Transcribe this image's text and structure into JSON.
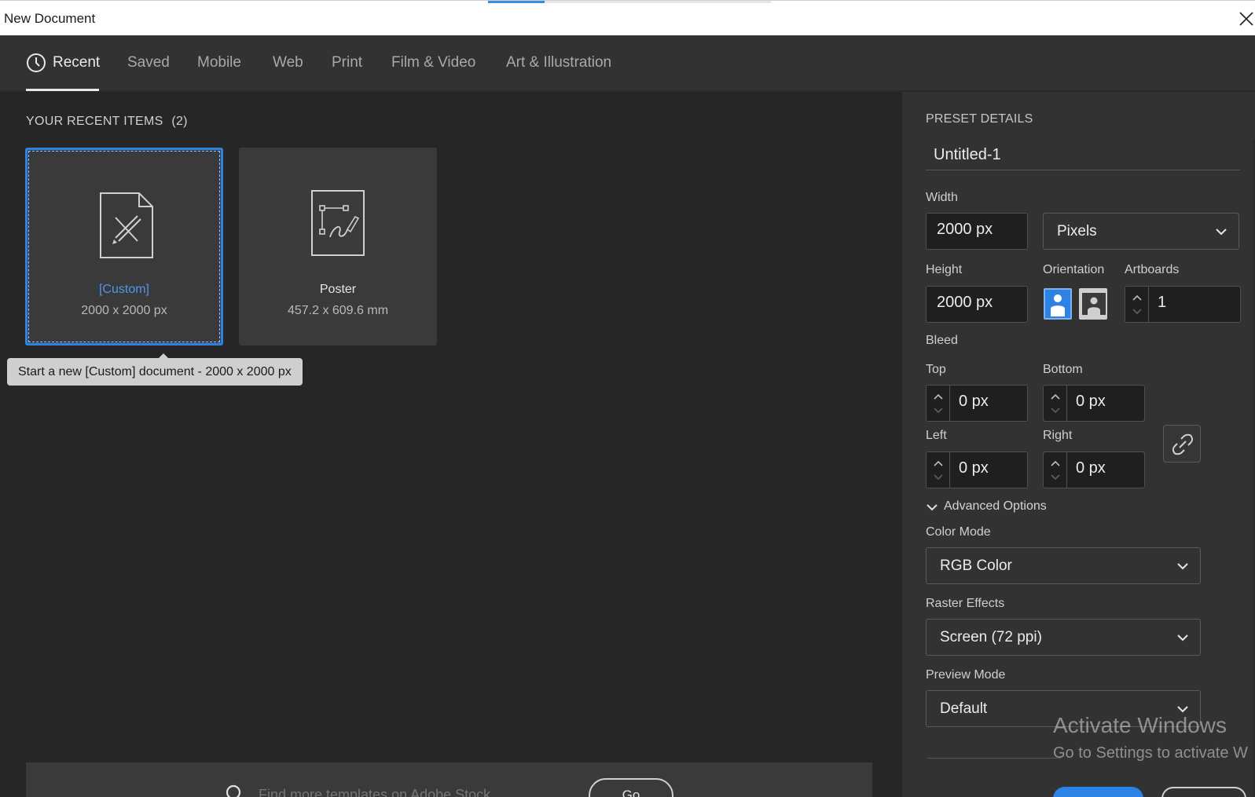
{
  "window": {
    "title": "New Document"
  },
  "tabs": [
    {
      "label": "Recent",
      "active": true
    },
    {
      "label": "Saved"
    },
    {
      "label": "Mobile"
    },
    {
      "label": "Web"
    },
    {
      "label": "Print"
    },
    {
      "label": "Film & Video"
    },
    {
      "label": "Art & Illustration"
    }
  ],
  "recent": {
    "heading": "YOUR RECENT ITEMS",
    "count": "(2)",
    "items": [
      {
        "name": "[Custom]",
        "size": "2000 x 2000 px",
        "icon": "document-tools-icon",
        "selected": true
      },
      {
        "name": "Poster",
        "size": "457.2 x 609.6 mm",
        "icon": "document-pen-icon",
        "selected": false
      }
    ],
    "tooltip": "Start a new [Custom] document - 2000 x 2000 px"
  },
  "stock": {
    "placeholder": "Find more templates on Adobe Stock",
    "go_label": "Go"
  },
  "preset": {
    "heading": "PRESET DETAILS",
    "name": "Untitled-1",
    "width_label": "Width",
    "width_value": "2000 px",
    "units_value": "Pixels",
    "height_label": "Height",
    "height_value": "2000 px",
    "orientation_label": "Orientation",
    "artboards_label": "Artboards",
    "artboards_value": "1",
    "bleed_label": "Bleed",
    "top_label": "Top",
    "top_value": "0 px",
    "bottom_label": "Bottom",
    "bottom_value": "0 px",
    "left_label": "Left",
    "left_value": "0 px",
    "right_label": "Right",
    "right_value": "0 px",
    "advanced_label": "Advanced Options",
    "color_mode_label": "Color Mode",
    "color_mode_value": "RGB Color",
    "raster_label": "Raster Effects",
    "raster_value": "Screen (72 ppi)",
    "preview_label": "Preview Mode",
    "preview_value": "Default"
  },
  "watermark": {
    "line1": "Activate Windows",
    "line2": "Go to Settings to activate W"
  },
  "colors": {
    "accent": "#2d82e5",
    "background": "#262626",
    "panel": "#323232"
  }
}
